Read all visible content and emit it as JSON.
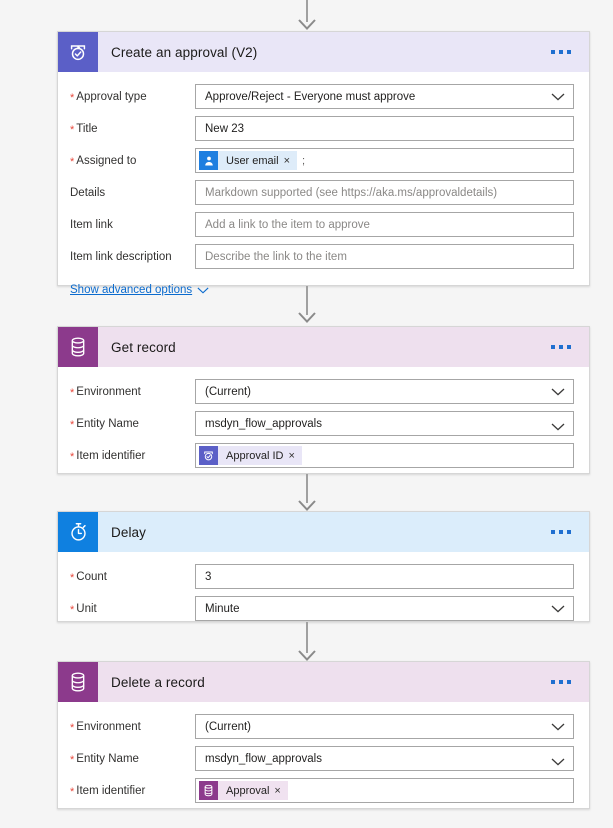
{
  "theme": {
    "page_bg": "#f5f5f5",
    "approval_accent": "#5b5fc7",
    "cds_accent": "#8c3a8c",
    "delay_accent": "#0f80e0",
    "required_marker": "#e8483c",
    "link_color": "#0b6bce"
  },
  "connector_icon": "arrow-down-icon",
  "menu_icon": "ellipsis-icon",
  "chevron_icon": "chevron-down-icon",
  "remove_icon": "close-icon",
  "cards": [
    {
      "title": "Create an approval (V2)",
      "icon": "approval-icon",
      "fields": [
        {
          "label": "Approval type",
          "required": true,
          "value": "Approve/Reject - Everyone must approve",
          "type": "dropdown"
        },
        {
          "label": "Title",
          "required": true,
          "value": "New 23",
          "type": "text"
        },
        {
          "label": "Assigned to",
          "required": true,
          "type": "token",
          "token": {
            "icon": "user-icon",
            "text": "User email",
            "remove": "×"
          },
          "suffix": ";"
        },
        {
          "label": "Details",
          "required": false,
          "placeholder": "Markdown supported (see https://aka.ms/approvaldetails)",
          "type": "text"
        },
        {
          "label": "Item link",
          "required": false,
          "placeholder": "Add a link to the item to approve",
          "type": "text"
        },
        {
          "label": "Item link description",
          "required": false,
          "placeholder": "Describe the link to the item",
          "type": "text"
        }
      ],
      "advanced_label": "Show advanced options"
    },
    {
      "title": "Get record",
      "icon": "database-icon",
      "fields": [
        {
          "label": "Environment",
          "required": true,
          "value": "(Current)",
          "type": "dropdown"
        },
        {
          "label": "Entity Name",
          "required": true,
          "value": "msdyn_flow_approvals",
          "type": "dropdown"
        },
        {
          "label": "Item identifier",
          "required": true,
          "type": "token",
          "token": {
            "icon": "approval-icon",
            "text": "Approval ID",
            "remove": "×"
          }
        }
      ]
    },
    {
      "title": "Delay",
      "icon": "stopwatch-icon",
      "fields": [
        {
          "label": "Count",
          "required": true,
          "value": "3",
          "type": "text"
        },
        {
          "label": "Unit",
          "required": true,
          "value": "Minute",
          "type": "dropdown"
        }
      ]
    },
    {
      "title": "Delete a record",
      "icon": "database-icon",
      "fields": [
        {
          "label": "Environment",
          "required": true,
          "value": "(Current)",
          "type": "dropdown"
        },
        {
          "label": "Entity Name",
          "required": true,
          "value": "msdyn_flow_approvals",
          "type": "dropdown"
        },
        {
          "label": "Item identifier",
          "required": true,
          "type": "token",
          "token": {
            "icon": "database-icon",
            "text": "Approval",
            "remove": "×"
          }
        }
      ]
    }
  ]
}
